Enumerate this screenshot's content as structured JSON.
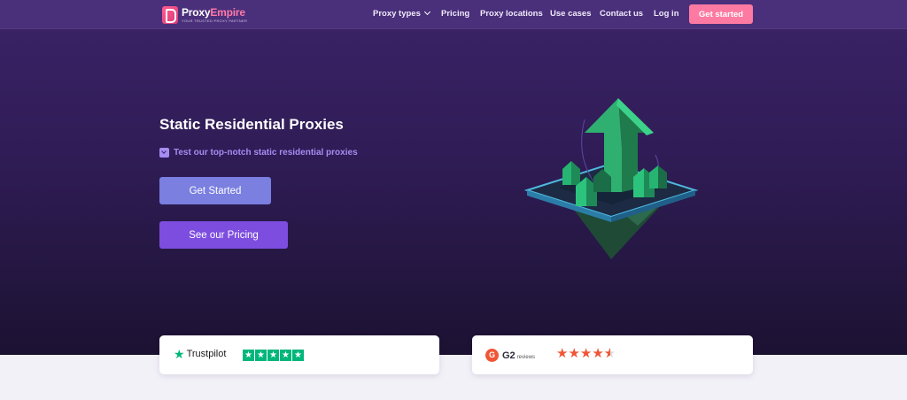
{
  "brand": {
    "name_part1": "Proxy",
    "name_part2": "Empire",
    "tagline": "YOUR TRUSTED PROXY PARTNER",
    "accent": "#ff7aa2"
  },
  "nav": {
    "items": [
      {
        "label": "Proxy types",
        "has_dropdown": true
      },
      {
        "label": "Pricing"
      },
      {
        "label": "Proxy locations"
      },
      {
        "label": "Use cases"
      },
      {
        "label": "Contact us"
      },
      {
        "label": "Log in"
      }
    ],
    "cta_label": "Get started"
  },
  "hero": {
    "title": "Static Residential Proxies",
    "subtitle": "Test our top-notch static residential proxies",
    "subtitle_icon": "download-icon",
    "primary_button": "Get Started",
    "secondary_button": "See our Pricing",
    "illustration": "isometric-green-arrow-houses"
  },
  "reviews": {
    "trustpilot": {
      "name": "Trustpilot",
      "stars": 5,
      "color": "#00b67a"
    },
    "g2": {
      "mark": "G",
      "name": "G2",
      "suffix": "reviews",
      "stars": 4.5,
      "color": "#f05535"
    }
  }
}
